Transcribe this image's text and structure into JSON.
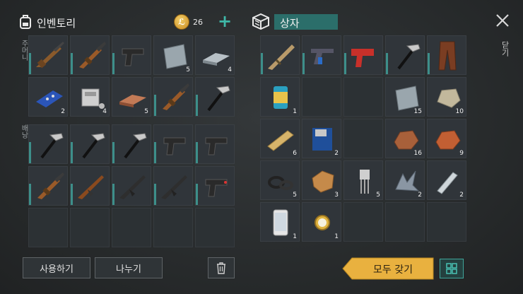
{
  "inventory": {
    "title": "인벤토리",
    "coins": "26",
    "plus": "+",
    "pocket_label": "주머니",
    "backpack_label": "배낭",
    "pocket_slots": [
      {
        "item": "rifle-icon",
        "count": ""
      },
      {
        "item": "shotgun-icon",
        "count": ""
      },
      {
        "item": "pistol-icon",
        "count": ""
      },
      {
        "item": "metal-plate-icon",
        "count": "5"
      },
      {
        "item": "iron-bar-icon",
        "count": "4"
      },
      {
        "item": "circuit-board-icon",
        "count": "2"
      },
      {
        "item": "engine-part-icon",
        "count": "4"
      },
      {
        "item": "copper-bar-icon",
        "count": "5"
      },
      {
        "item": "shotgun-icon",
        "count": ""
      },
      {
        "item": "hammer-icon",
        "count": ""
      }
    ],
    "backpack_slots": [
      {
        "item": "hammer-icon",
        "count": ""
      },
      {
        "item": "hammer-icon",
        "count": ""
      },
      {
        "item": "hammer-icon",
        "count": ""
      },
      {
        "item": "pistol-icon",
        "count": ""
      },
      {
        "item": "pistol-icon",
        "count": ""
      },
      {
        "item": "shotgun-icon",
        "count": ""
      },
      {
        "item": "ak-rifle-icon",
        "count": ""
      },
      {
        "item": "assault-rifle-icon",
        "count": ""
      },
      {
        "item": "assault-rifle-icon",
        "count": ""
      },
      {
        "item": "pistol-red-icon",
        "count": ""
      }
    ],
    "use_button": "사용하기",
    "split_button": "나누기"
  },
  "box": {
    "title": "상자",
    "slots": [
      {
        "item": "scar-rifle-icon",
        "count": ""
      },
      {
        "item": "revolver-icon",
        "count": ""
      },
      {
        "item": "flare-gun-icon",
        "count": ""
      },
      {
        "item": "hammer-icon",
        "count": ""
      },
      {
        "item": "leather-pants-icon",
        "count": ""
      },
      {
        "item": "canned-food-icon",
        "count": "1"
      },
      {
        "item": "",
        "count": ""
      },
      {
        "item": "",
        "count": ""
      },
      {
        "item": "metal-plate-icon",
        "count": "15"
      },
      {
        "item": "stone-icon",
        "count": "10"
      },
      {
        "item": "wood-plank-icon",
        "count": "6"
      },
      {
        "item": "floppy-disk-icon",
        "count": "2"
      },
      {
        "item": "",
        "count": ""
      },
      {
        "item": "copper-ore-icon",
        "count": "16"
      },
      {
        "item": "iron-ore-icon",
        "count": "9"
      },
      {
        "item": "rubber-rings-icon",
        "count": "5"
      },
      {
        "item": "leather-icon",
        "count": "3"
      },
      {
        "item": "transistor-icon",
        "count": "5"
      },
      {
        "item": "scrap-metal-icon",
        "count": "2"
      },
      {
        "item": "water-bottle-icon",
        "count": "2"
      },
      {
        "item": "smartphone-icon",
        "count": "1"
      },
      {
        "item": "gold-watch-icon",
        "count": "1"
      }
    ],
    "take_all_button": "모두 갖기"
  },
  "close_label": "닫기"
}
